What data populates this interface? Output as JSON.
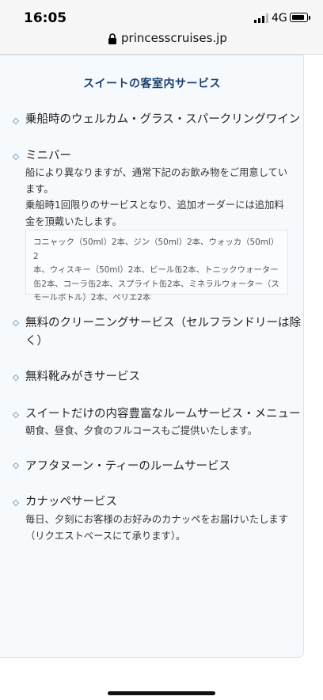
{
  "status_bar": {
    "time": "16:05",
    "network": "4G"
  },
  "browser": {
    "url": "princesscruises.jp"
  },
  "section": {
    "title": "スイートの客室内サービス",
    "items": [
      {
        "title": "乗船時のウェルカム・グラス・スパークリングワイン"
      },
      {
        "title": "ミニバー",
        "description_lines": [
          "船により異なりますが、通常下記のお飲み物をご用意してい",
          "ます。",
          "乗船時1回限りのサービスとなり、追加オーダーには追加料",
          "金を頂戴いたします。"
        ],
        "note_lines": [
          "コニャック（50ml）2本、ジン（50ml）2本、ウォッカ（50ml）2",
          "本、ウィスキー（50ml）2本、ビール缶2本、トニックウォーター",
          "缶2本、コーラ缶2本、スプライト缶2本、ミネラルウォーター（ス",
          "モールボトル）2本、ペリエ2本"
        ]
      },
      {
        "title_lines": [
          "無料のクリーニングサービス（セルフランドリーは除",
          "く）"
        ]
      },
      {
        "title": "無料靴みがきサービス"
      },
      {
        "title": "スイートだけの内容豊富なルームサービス・メニュー",
        "description": "朝食、昼食、夕食のフルコースもご提供いたします。"
      },
      {
        "title": "アフタヌーン・ティーのルームサービス"
      },
      {
        "title": "カナッペサービス",
        "description_lines": [
          "毎日、夕刻にお客様のお好みのカナッペをお届けいたします",
          "（リクエストベースにて承ります）。"
        ]
      }
    ]
  }
}
